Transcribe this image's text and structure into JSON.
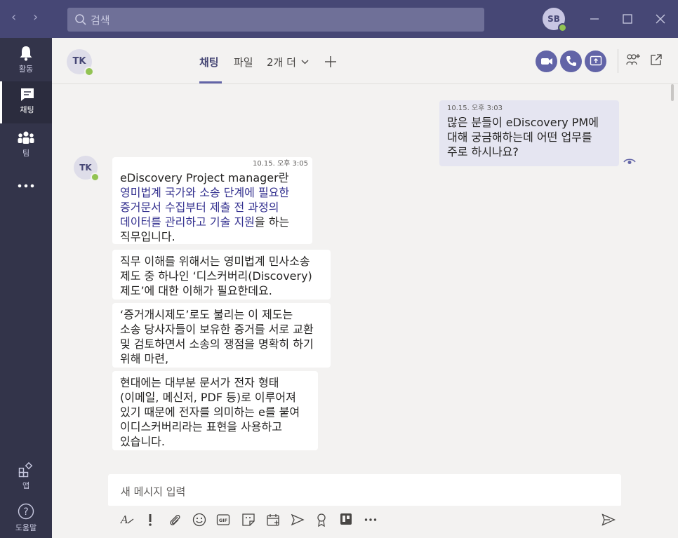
{
  "titlebar": {
    "back_icon": "chevron-left-icon",
    "forward_icon": "chevron-right-icon",
    "search_placeholder": "검색",
    "user_initials": "SB",
    "window_controls": [
      "minimize-icon",
      "maximize-icon",
      "close-icon"
    ]
  },
  "rail": {
    "items": [
      {
        "label": "활동",
        "icon": "bell-icon"
      },
      {
        "label": "채팅",
        "icon": "chat-icon",
        "active": true
      },
      {
        "label": "팀",
        "icon": "teams-icon"
      },
      {
        "label": "",
        "icon": "more-icon"
      }
    ],
    "bottom": [
      {
        "label": "앱",
        "icon": "apps-icon"
      },
      {
        "label": "도움말",
        "icon": "help-icon"
      }
    ]
  },
  "header": {
    "peer_initials": "TK",
    "tabs": [
      {
        "label": "채팅",
        "active": true
      },
      {
        "label": "파일"
      },
      {
        "label": "2개 더"
      }
    ],
    "add_tab_icon": "plus-icon",
    "actions": [
      "video-call-icon",
      "phone-call-icon",
      "screen-share-icon",
      "add-people-icon",
      "pop-out-icon"
    ]
  },
  "messages": {
    "outgoing": {
      "timestamp": "10.15. 오후 3:03",
      "lines": [
        "많은 분들이 eDiscovery PM에",
        "대해 궁금해하는데 어떤 업무를",
        "주로 하시나요?"
      ],
      "read_receipt_icon": "seen-eye-icon"
    },
    "incoming_avatar": "TK",
    "incoming_timestamp": "10.15. 오후 3:05",
    "m1": {
      "line1": "eDiscovery Project manager란",
      "hl1": "영미법계 국가와 소송 단계에 필요한",
      "hl2": "증거문서 수집부터 제출 전 과정의",
      "hl3": "데이터를 관리하고 기술 지원",
      "tail3": "을 하는",
      "line5": "직무입니다."
    },
    "m2": [
      "직무 이해를 위해서는 영미법계 민사소송",
      "제도 중 하나인 ‘디스커버리(Discovery)",
      "제도’에 대한 이해가 필요한데요."
    ],
    "m3": [
      "‘증거개시제도’로도 불리는 이 제도는",
      "소송 당사자들이 보유한 증거를 서로 교환",
      "및 검토하면서 소송의 쟁점을 명확히 하기",
      "위해 마련,"
    ],
    "m4": [
      "현대에는 대부분 문서가 전자 형태",
      "(이메일, 메신저, PDF 등)로 이루어져",
      "있기 때문에 전자를 의미하는 e를 붙여",
      "이디스커버리라는 표현을 사용하고",
      "있습니다."
    ]
  },
  "compose": {
    "placeholder": "새 메시지 입력",
    "toolbar": [
      "format-icon",
      "important-icon",
      "attach-icon",
      "emoji-icon",
      "gif-icon",
      "sticker-icon",
      "meeting-icon",
      "stream-icon",
      "praise-icon",
      "trello-icon",
      "more-options-icon"
    ],
    "send_icon": "send-icon"
  },
  "colors": {
    "titlebar": "#464775",
    "rail": "#33344a",
    "accent": "#6264a7",
    "highlight_text": "#33308f",
    "presence": "#92c353",
    "my_bubble": "#e5e5f1"
  }
}
